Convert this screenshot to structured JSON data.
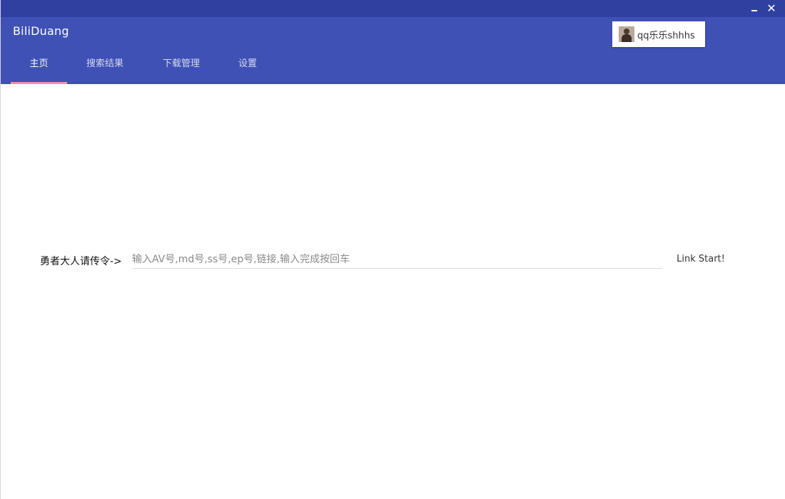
{
  "app": {
    "title": "BiliDuang"
  },
  "window_controls": {
    "minimize_icon": "minimize-icon",
    "close_icon": "close-icon",
    "close_glyph": "✕"
  },
  "user": {
    "name": "qq乐乐shhhs",
    "avatar": "user-avatar"
  },
  "tabs": [
    {
      "label": "主页",
      "active": true
    },
    {
      "label": "搜索结果",
      "active": false
    },
    {
      "label": "下载管理",
      "active": false
    },
    {
      "label": "设置",
      "active": false
    }
  ],
  "command": {
    "label": "勇者大人请传令->",
    "placeholder": "输入AV号,md号,ss号,ep号,链接,输入完成按回车",
    "value": "",
    "button_label": "Link Start!"
  },
  "colors": {
    "titlebar": "#3040a0",
    "header": "#3f51b5",
    "tab_indicator": "#f48fb1",
    "background": "#ffffff"
  }
}
